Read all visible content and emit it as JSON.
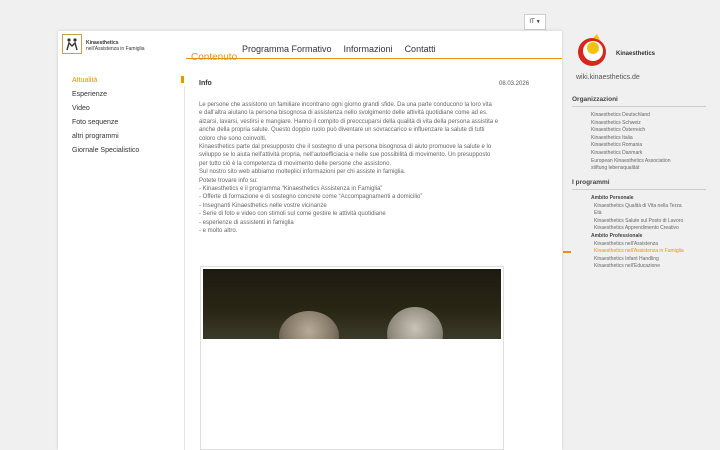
{
  "header": {
    "language": "IT",
    "logo_line1": "Kinaesthetics",
    "logo_line2": "nell'Assistenza in Famiglia",
    "section_title": "Contenuto",
    "nav": [
      "Programma Formativo",
      "Informazioni",
      "Contatti"
    ]
  },
  "left_menu": {
    "items": [
      "Attualità",
      "Esperienze",
      "Video",
      "Foto sequenze",
      "altri programmi",
      "Giornale Specialistico"
    ]
  },
  "article": {
    "title": "Info",
    "date": "08.03.2026",
    "lines": [
      "Le persone che assistono un familiare incontrano ogni giorno grandi sfide. Da una parte conducono la loro vita",
      "e dall'altra aiutano la persona bisognosa di assistenza nello svolgimento delle attività quotidiane come ad es.",
      "alzarsi, lavarsi, vestirsi e mangiare. Hanno il compito di preoccuparsi della qualità di vita della persona assistita e",
      "anche della propria salute. Questo doppio ruolo può diventare un sovraccarico e influenzare la salute di tutti",
      "coloro che sono coinvolti.",
      "Kinaesthetics parte dal presupposto che il sostegno di una persona bisognosa di aiuto promuove la salute e lo",
      "sviluppo se lo aiuta nell'attività propria, nell'autoefficiacia e nelle sue possibilità di movimento. Un presupposto",
      "per tutto ciò è la competenza di movimento delle persone che assistono.",
      "Sul nostro sito web abbiamo molteplici informazioni per chi assiste in famiglia.",
      "Potete trovare info su:",
      "- Kinaesthetics e il programma “Kinaesthetics Assistenza in Famiglia”",
      "- Offerte di formazione e di sostegno concrete come “Accompagnamenti a domicilio”",
      "- Insegnanti Kinaesthetics nelle vostre vicinanze",
      "- Serie di foto e video con stimoli sul come gestire le attività quotidiane",
      "- esperienze di assistenti in famiglia",
      "- e molto altro."
    ]
  },
  "sidebar": {
    "brand": "Kinaesthetics",
    "wiki": "wiki.kinaesthetics.de",
    "org_heading": "Organizzazioni",
    "orgs": [
      "Kinaesthetics Deutschland",
      "Kinaesthetics Schweiz",
      "Kinaesthetics Österreich",
      "Kinaesthetics Italia",
      "Kinaesthetics Romania",
      "Kinaesthetics Danmark",
      "European Kinaesthetics Association",
      "stiftung lebensqualität"
    ],
    "prog_heading": "I programmi",
    "ambito_personale": "Ambito Personale",
    "personale_items": [
      "Kinaesthetics Qualità di Vita nella Terza",
      "Età",
      "Kinaesthetics Salute sul Posto di Lavoro",
      "Kinaesthetics Apprendimento Creativo"
    ],
    "ambito_professionale": "Ambito Professionale",
    "professionale_items": [
      "Kinaesthetics nell'Assistenza",
      "Kinaesthetics nell'Assistenza in Famiglia",
      "Kinaesthetics Infant Handling",
      "Kinaesthetics nell'Educazione"
    ]
  },
  "colors": {
    "accent": "#e8920f",
    "logo_red": "#d9261c",
    "logo_yellow": "#f2c20f"
  }
}
